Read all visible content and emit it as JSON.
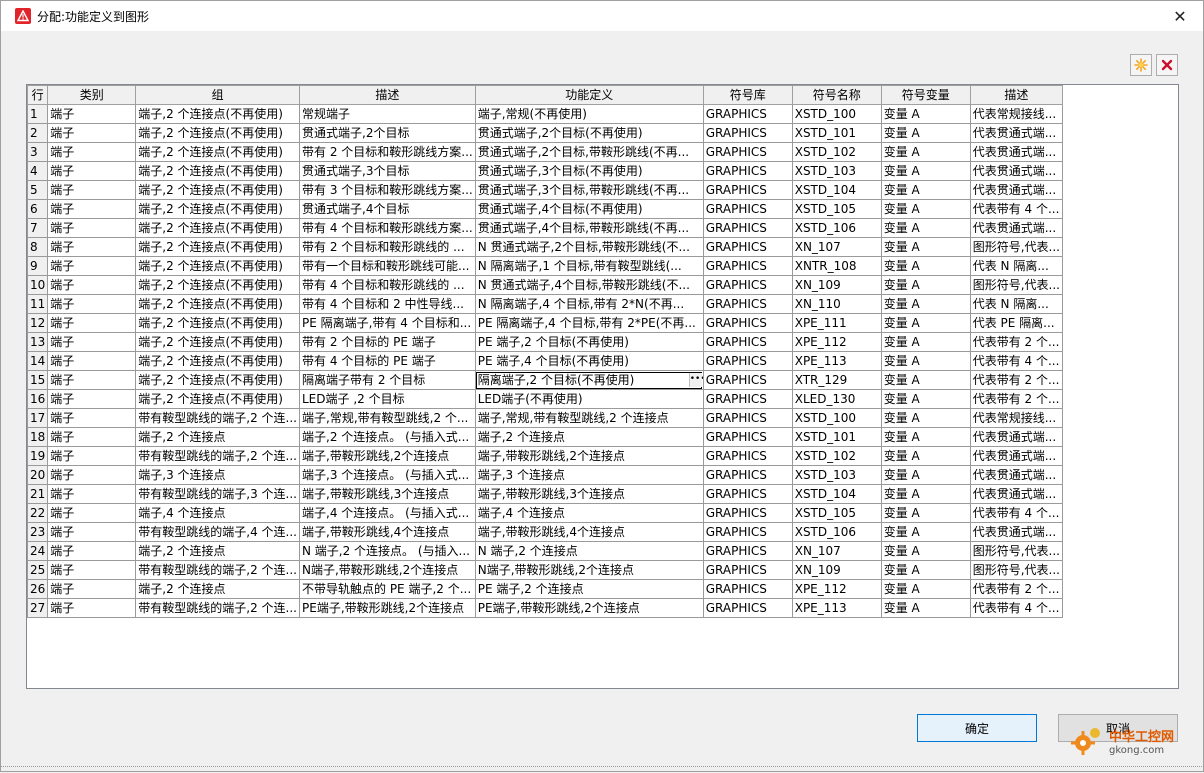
{
  "window": {
    "title": "分配:功能定义到图形",
    "close_glyph": "✕"
  },
  "toolbar": {
    "new_icon": "star-burst-icon",
    "delete_icon": "red-x-icon"
  },
  "grid": {
    "columns": [
      "行",
      "类别",
      "组",
      "描述",
      "功能定义",
      "符号库",
      "符号名称",
      "符号变量",
      "描述"
    ],
    "rows": [
      [
        "1",
        "端子",
        "端子,2 个连接点(不再使用)",
        "常规端子",
        "端子,常规(不再使用)",
        "GRAPHICS",
        "XSTD_100",
        "变量 A",
        "代表常规接线..."
      ],
      [
        "2",
        "端子",
        "端子,2 个连接点(不再使用)",
        "贯通式端子,2个目标",
        "贯通式端子,2个目标(不再使用)",
        "GRAPHICS",
        "XSTD_101",
        "变量 A",
        "代表贯通式端..."
      ],
      [
        "3",
        "端子",
        "端子,2 个连接点(不再使用)",
        "带有 2 个目标和鞍形跳线方案...",
        "贯通式端子,2个目标,带鞍形跳线(不再...",
        "GRAPHICS",
        "XSTD_102",
        "变量 A",
        "代表贯通式端..."
      ],
      [
        "4",
        "端子",
        "端子,2 个连接点(不再使用)",
        "贯通式端子,3个目标",
        "贯通式端子,3个目标(不再使用)",
        "GRAPHICS",
        "XSTD_103",
        "变量 A",
        "代表贯通式端..."
      ],
      [
        "5",
        "端子",
        "端子,2 个连接点(不再使用)",
        "带有 3 个目标和鞍形跳线方案...",
        "贯通式端子,3个目标,带鞍形跳线(不再...",
        "GRAPHICS",
        "XSTD_104",
        "变量 A",
        "代表贯通式端..."
      ],
      [
        "6",
        "端子",
        "端子,2 个连接点(不再使用)",
        "贯通式端子,4个目标",
        "贯通式端子,4个目标(不再使用)",
        "GRAPHICS",
        "XSTD_105",
        "变量 A",
        "代表带有 4 个..."
      ],
      [
        "7",
        "端子",
        "端子,2 个连接点(不再使用)",
        "带有 4 个目标和鞍形跳线方案...",
        "贯通式端子,4个目标,带鞍形跳线(不再...",
        "GRAPHICS",
        "XSTD_106",
        "变量 A",
        "代表贯通式端..."
      ],
      [
        "8",
        "端子",
        "端子,2 个连接点(不再使用)",
        "带有 2 个目标和鞍形跳线的 ...",
        "N 贯通式端子,2个目标,带鞍形跳线(不...",
        "GRAPHICS",
        "XN_107",
        "变量 A",
        "图形符号,代表..."
      ],
      [
        "9",
        "端子",
        "端子,2 个连接点(不再使用)",
        "带有一个目标和鞍形跳线可能...",
        "N 隔离端子,1 个目标,带有鞍型跳线(...",
        "GRAPHICS",
        "XNTR_108",
        "变量 A",
        "代表 N 隔离..."
      ],
      [
        "10",
        "端子",
        "端子,2 个连接点(不再使用)",
        "带有 4 个目标和鞍形跳线的 ...",
        "N 贯通式端子,4个目标,带鞍形跳线(不...",
        "GRAPHICS",
        "XN_109",
        "变量 A",
        "图形符号,代表..."
      ],
      [
        "11",
        "端子",
        "端子,2 个连接点(不再使用)",
        "带有 4 个目标和 2 中性导线...",
        "N 隔离端子,4 个目标,带有 2*N(不再...",
        "GRAPHICS",
        "XN_110",
        "变量 A",
        "代表 N 隔离..."
      ],
      [
        "12",
        "端子",
        "端子,2 个连接点(不再使用)",
        "PE 隔离端子,带有 4 个目标和...",
        "PE 隔离端子,4 个目标,带有 2*PE(不再...",
        "GRAPHICS",
        "XPE_111",
        "变量 A",
        "代表 PE 隔离..."
      ],
      [
        "13",
        "端子",
        "端子,2 个连接点(不再使用)",
        "带有 2 个目标的 PE 端子",
        "PE 端子,2 个目标(不再使用)",
        "GRAPHICS",
        "XPE_112",
        "变量 A",
        "代表带有 2 个..."
      ],
      [
        "14",
        "端子",
        "端子,2 个连接点(不再使用)",
        "带有 4 个目标的 PE 端子",
        "PE 端子,4 个目标(不再使用)",
        "GRAPHICS",
        "XPE_113",
        "变量 A",
        "代表带有 4 个..."
      ],
      [
        "15",
        "端子",
        "端子,2 个连接点(不再使用)",
        "隔离端子带有 2 个目标",
        "隔离端子,2 个目标(不再使用)",
        "GRAPHICS",
        "XTR_129",
        "变量 A",
        "代表带有 2 个..."
      ],
      [
        "16",
        "端子",
        "端子,2 个连接点(不再使用)",
        "LED端子 ,2 个目标",
        "LED端子(不再使用)",
        "GRAPHICS",
        "XLED_130",
        "变量 A",
        "代表带有 2 个..."
      ],
      [
        "17",
        "端子",
        "带有鞍型跳线的端子,2 个连...",
        "端子,常规,带有鞍型跳线,2 个...",
        "端子,常规,带有鞍型跳线,2 个连接点",
        "GRAPHICS",
        "XSTD_100",
        "变量 A",
        "代表常规接线..."
      ],
      [
        "18",
        "端子",
        "端子,2 个连接点",
        "端子,2 个连接点。 (与插入式...",
        "端子,2 个连接点",
        "GRAPHICS",
        "XSTD_101",
        "变量 A",
        "代表贯通式端..."
      ],
      [
        "19",
        "端子",
        "带有鞍型跳线的端子,2 个连...",
        "端子,带鞍形跳线,2个连接点",
        "端子,带鞍形跳线,2个连接点",
        "GRAPHICS",
        "XSTD_102",
        "变量 A",
        "代表贯通式端..."
      ],
      [
        "20",
        "端子",
        "端子,3 个连接点",
        "端子,3 个连接点。 (与插入式...",
        "端子,3 个连接点",
        "GRAPHICS",
        "XSTD_103",
        "变量 A",
        "代表贯通式端..."
      ],
      [
        "21",
        "端子",
        "带有鞍型跳线的端子,3 个连...",
        "端子,带鞍形跳线,3个连接点",
        "端子,带鞍形跳线,3个连接点",
        "GRAPHICS",
        "XSTD_104",
        "变量 A",
        "代表贯通式端..."
      ],
      [
        "22",
        "端子",
        "端子,4 个连接点",
        "端子,4 个连接点。 (与插入式...",
        "端子,4 个连接点",
        "GRAPHICS",
        "XSTD_105",
        "变量 A",
        "代表带有 4 个..."
      ],
      [
        "23",
        "端子",
        "带有鞍型跳线的端子,4 个连...",
        "端子,带鞍形跳线,4个连接点",
        "端子,带鞍形跳线,4个连接点",
        "GRAPHICS",
        "XSTD_106",
        "变量 A",
        "代表贯通式端..."
      ],
      [
        "24",
        "端子",
        "端子,2 个连接点",
        "N 端子,2 个连接点。 (与插入...",
        "N 端子,2 个连接点",
        "GRAPHICS",
        "XN_107",
        "变量 A",
        "图形符号,代表..."
      ],
      [
        "25",
        "端子",
        "带有鞍型跳线的端子,2 个连...",
        "N端子,带鞍形跳线,2个连接点",
        "N端子,带鞍形跳线,2个连接点",
        "GRAPHICS",
        "XN_109",
        "变量 A",
        "图形符号,代表..."
      ],
      [
        "26",
        "端子",
        "端子,2 个连接点",
        "不带导轨触点的 PE 端子,2 个...",
        "PE 端子,2 个连接点",
        "GRAPHICS",
        "XPE_112",
        "变量 A",
        "代表带有 2 个..."
      ],
      [
        "27",
        "端子",
        "带有鞍型跳线的端子,2 个连...",
        "PE端子,带鞍形跳线,2个连接点",
        "PE端子,带鞍形跳线,2个连接点",
        "GRAPHICS",
        "XPE_113",
        "变量 A",
        "代表带有 4 个..."
      ]
    ],
    "selected_row": 15,
    "focus_column": 4
  },
  "footer": {
    "ok_label": "确定",
    "cancel_label": "取消"
  },
  "watermark": {
    "brand": "中华工控网",
    "url": "gkong.com"
  },
  "colors": {
    "accent": "#0078d7",
    "app_icon": "#e1242a",
    "delete_icon": "#c8102e",
    "new_icon": "#f5a623"
  }
}
